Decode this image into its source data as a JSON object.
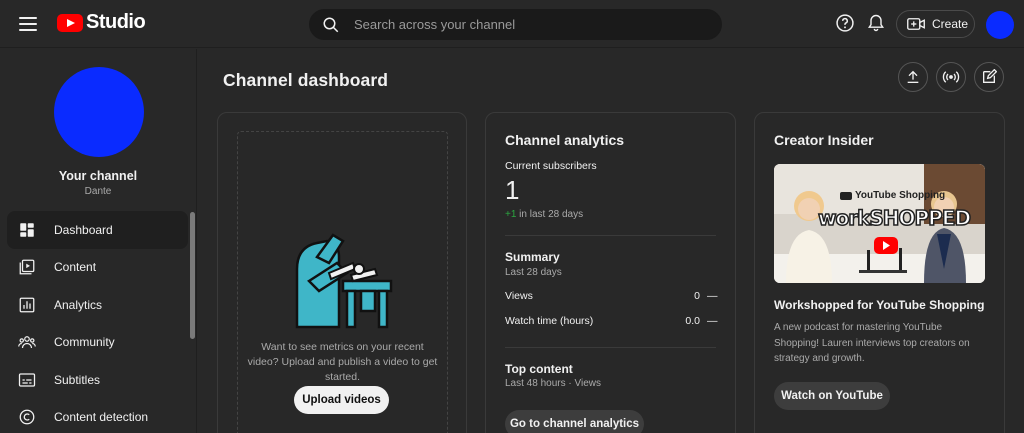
{
  "header": {
    "logo_text": "Studio",
    "search_placeholder": "Search across your channel",
    "create_label": "Create"
  },
  "sidebar": {
    "channel_label": "Your channel",
    "channel_name": "Dante",
    "items": [
      {
        "label": "Dashboard",
        "icon": "dashboard-icon",
        "active": true
      },
      {
        "label": "Content",
        "icon": "content-icon"
      },
      {
        "label": "Analytics",
        "icon": "analytics-icon"
      },
      {
        "label": "Community",
        "icon": "community-icon"
      },
      {
        "label": "Subtitles",
        "icon": "subtitles-icon"
      },
      {
        "label": "Content detection",
        "icon": "content-detection-icon"
      }
    ]
  },
  "main": {
    "title": "Channel dashboard",
    "actions": [
      "upload-icon",
      "live-icon",
      "edit-icon"
    ]
  },
  "video_card": {
    "empty_text": "Want to see metrics on your recent video? Upload and publish a video to get started.",
    "upload_label": "Upload videos"
  },
  "analytics": {
    "title": "Channel analytics",
    "subscribers_label": "Current subscribers",
    "subscribers_count": "1",
    "subscribers_change": "+1",
    "subscribers_change_period": " in last 28 days",
    "summary_title": "Summary",
    "summary_period": "Last 28 days",
    "views_label": "Views",
    "views_value": "0",
    "watch_label": "Watch time (hours)",
    "watch_value": "0.0",
    "trend_symbol": "—",
    "top_content_title": "Top content",
    "top_content_period": "Last 48 hours · Views",
    "go_label": "Go to channel analytics"
  },
  "insider": {
    "title": "Creator Insider",
    "thumb_badge": "YouTube Shopping",
    "thumb_title": "workSHOPPED",
    "video_title": "Workshopped for YouTube Shopping",
    "video_desc": "A new podcast for mastering YouTube Shopping! Lauren interviews top creators on strategy and growth.",
    "watch_label": "Watch on YouTube"
  },
  "colors": {
    "background": "#282828",
    "accent_red": "#ff0000",
    "avatar_blue": "#0a2bff",
    "positive_green": "#2ba640",
    "illustration_teal": "#3fb6c8"
  }
}
